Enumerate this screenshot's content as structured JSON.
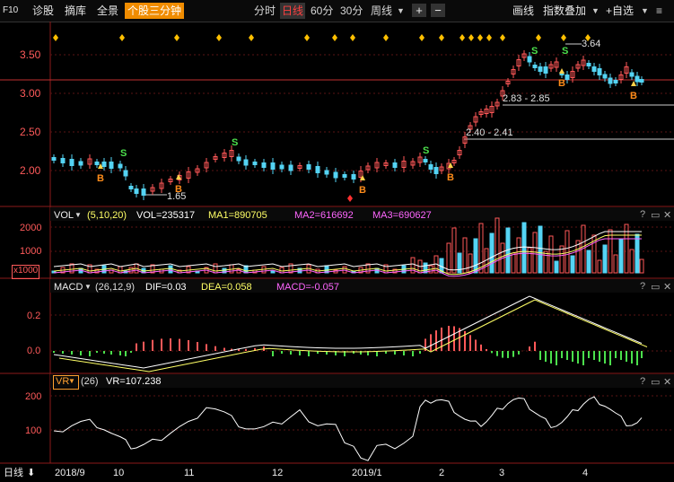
{
  "toolbar": {
    "f10": "F10",
    "items": [
      "诊股",
      "摘库",
      "全景"
    ],
    "selected_tab": "个股三分钟",
    "periods": [
      "分时",
      "日线",
      "60分",
      "30分",
      "周线"
    ],
    "active_period": "日线",
    "zoom_in": "+",
    "zoom_out": "−",
    "draw": "画线",
    "index_overlay": "指数叠加",
    "watchlist_add": "+自选"
  },
  "main_chart": {
    "y_ticks": [
      "3.50",
      "3.00",
      "2.50",
      "2.00"
    ],
    "annotations": [
      "3.64",
      "2.83 - 2.85",
      "2.40 - 2.41",
      "1.65"
    ],
    "buy_label": "B",
    "sell_label": "S",
    "colors": {
      "up": "#ff5858",
      "down": "#54d4f4",
      "buy": "#ff8c1a",
      "sell": "#4ce04c",
      "diamond": "#ffc000"
    }
  },
  "vol_panel": {
    "name": "VOL",
    "params": "(5,10,20)",
    "vol": "VOL=235317",
    "ma1": "MA1=890705",
    "ma2": "MA2=616692",
    "ma3": "MA3=690627",
    "y_ticks": [
      "2000",
      "1000"
    ],
    "unit": "x1000"
  },
  "macd_panel": {
    "name": "MACD",
    "params": "(26,12,9)",
    "dif": "DIF=0.03",
    "dea": "DEA=0.058",
    "macd": "MACD=-0.057",
    "y_ticks": [
      "0.2",
      "0.0"
    ]
  },
  "vr_panel": {
    "name": "VR",
    "params": "(26)",
    "value": "VR=107.238",
    "y_ticks": [
      "200",
      "100"
    ]
  },
  "panel_controls": [
    "?",
    "▭",
    "✕"
  ],
  "x_axis": {
    "period_label": "日线",
    "labels": [
      "2018/9",
      "10",
      "11",
      "12",
      "2019/1",
      "2",
      "3",
      "4"
    ]
  }
}
